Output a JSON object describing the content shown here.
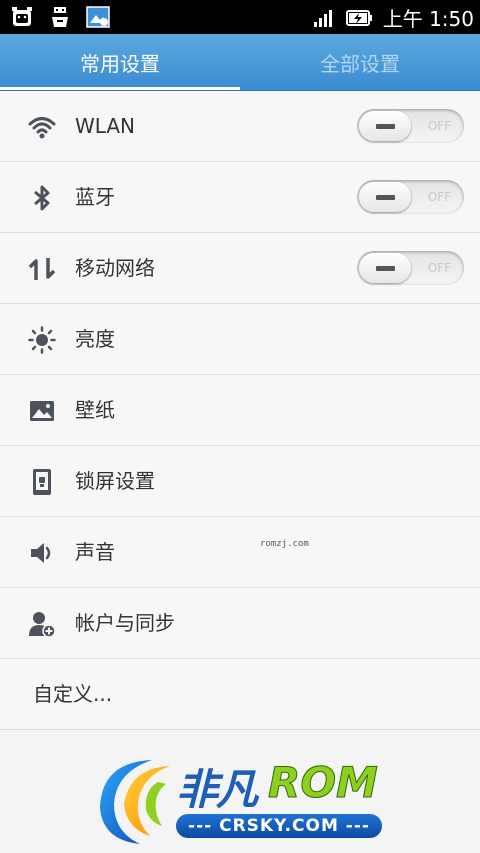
{
  "statusbar": {
    "time": "上午 1:50"
  },
  "tabs": [
    {
      "label": "常用设置",
      "active": true
    },
    {
      "label": "全部设置",
      "active": false
    }
  ],
  "rows": [
    {
      "label": "WLAN",
      "icon": "wifi-icon",
      "toggle": "OFF"
    },
    {
      "label": "蓝牙",
      "icon": "bluetooth-icon",
      "toggle": "OFF"
    },
    {
      "label": "移动网络",
      "icon": "mobile-data-icon",
      "toggle": "OFF"
    },
    {
      "label": "亮度",
      "icon": "brightness-icon"
    },
    {
      "label": "壁纸",
      "icon": "wallpaper-icon"
    },
    {
      "label": "锁屏设置",
      "icon": "lockscreen-icon"
    },
    {
      "label": "声音",
      "icon": "volume-icon"
    },
    {
      "label": "帐户与同步",
      "icon": "account-add-icon"
    },
    {
      "label": "自定义..."
    }
  ],
  "watermark": {
    "small": "romzj.com",
    "logo_cn": "非凡",
    "logo_rom": "ROM",
    "logo_domain": "--- CRSKY.COM ---"
  },
  "colors": {
    "tabbar": "#3b8bd2",
    "statusbar": "#000000",
    "list_bg": "#f7f7f7"
  }
}
